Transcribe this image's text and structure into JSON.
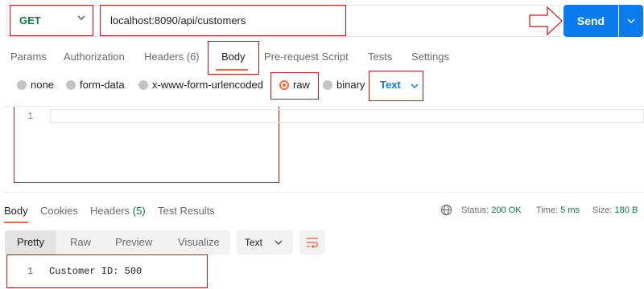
{
  "request": {
    "method": "GET",
    "url": "localhost:8090/api/customers",
    "send_label": "Send"
  },
  "request_tabs": {
    "params": "Params",
    "authorization": "Authorization",
    "headers": "Headers (6)",
    "body": "Body",
    "prerequest": "Pre-request Script",
    "tests": "Tests",
    "settings": "Settings"
  },
  "body_types": {
    "none": "none",
    "form_data": "form-data",
    "urlencoded": "x-www-form-urlencoded",
    "raw": "raw",
    "binary": "binary",
    "selected": "raw",
    "format": "Text"
  },
  "editor": {
    "line_number": "1",
    "content": ""
  },
  "response_tabs": {
    "body": "Body",
    "cookies": "Cookies",
    "headers_label": "Headers",
    "headers_count": "(5)",
    "test_results": "Test Results"
  },
  "response_meta": {
    "status_label": "Status:",
    "status_value": "200 OK",
    "time_label": "Time:",
    "time_value": "5 ms",
    "size_label": "Size:",
    "size_value": "180 B"
  },
  "response_view": {
    "pretty": "Pretty",
    "raw": "Raw",
    "preview": "Preview",
    "visualize": "Visualize",
    "format": "Text"
  },
  "response_body": {
    "line_number": "1",
    "content": "Customer ID: 500"
  },
  "colors": {
    "accent": "#ff6c37",
    "send": "#097bed",
    "method_get": "#0b7a3e",
    "annotation": "#c0161c"
  },
  "icons": [
    "chevron-down-icon",
    "arrow-right-icon",
    "globe-icon",
    "wrap-lines-icon"
  ]
}
